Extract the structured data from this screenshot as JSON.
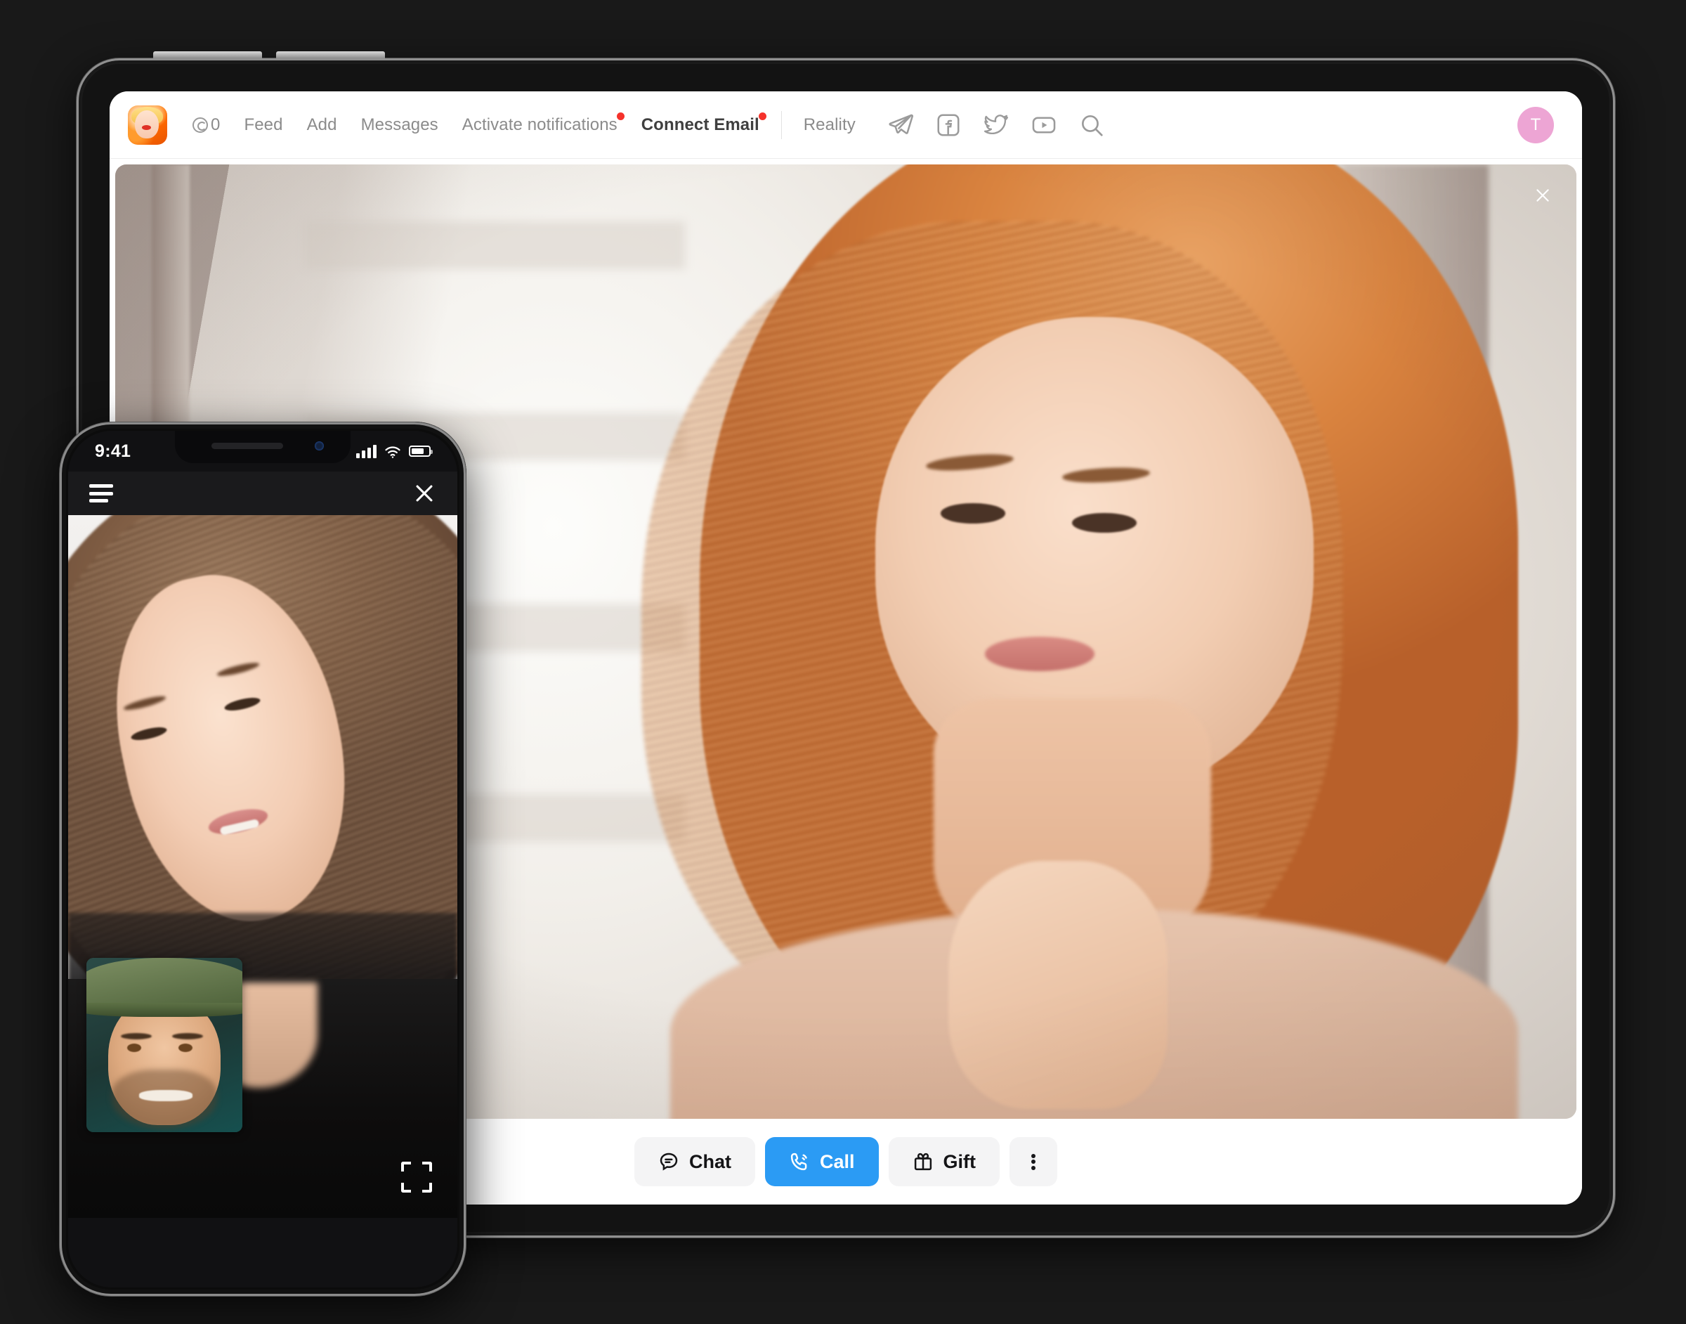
{
  "tablet": {
    "brand": {
      "logo_name": "app-logo-blonde-woman"
    },
    "nav": {
      "coin_count": "0",
      "items": [
        {
          "label": "Feed",
          "badge": false,
          "strong": false
        },
        {
          "label": "Add",
          "badge": false,
          "strong": false
        },
        {
          "label": "Messages",
          "badge": false,
          "strong": false
        },
        {
          "label": "Activate notifications",
          "badge": true,
          "strong": false
        },
        {
          "label": "Connect Email",
          "badge": true,
          "strong": true
        },
        {
          "label": "Reality",
          "badge": false,
          "strong": false
        }
      ],
      "social": [
        {
          "name": "telegram-icon"
        },
        {
          "name": "facebook-icon"
        },
        {
          "name": "twitter-icon"
        },
        {
          "name": "youtube-icon"
        },
        {
          "name": "search-icon"
        }
      ],
      "avatar_initial": "T",
      "avatar_color": "#eda5d4"
    },
    "video": {
      "subject": "red-haired woman portrait",
      "close_label": "×"
    },
    "actions": {
      "chat_label": "Chat",
      "call_label": "Call",
      "gift_label": "Gift",
      "more_label": "More options",
      "call_color": "#2b9bf4"
    }
  },
  "phone": {
    "status": {
      "time": "9:41",
      "signal": "signal-bars-icon",
      "wifi": "wifi-icon",
      "battery": "battery-icon"
    },
    "topbar": {
      "menu_label": "menu",
      "close_label": "close"
    },
    "video": {
      "subject": "brown-haired smiling woman",
      "pip_subject": "man with green flat cap",
      "fullscreen_label": "fullscreen"
    }
  }
}
